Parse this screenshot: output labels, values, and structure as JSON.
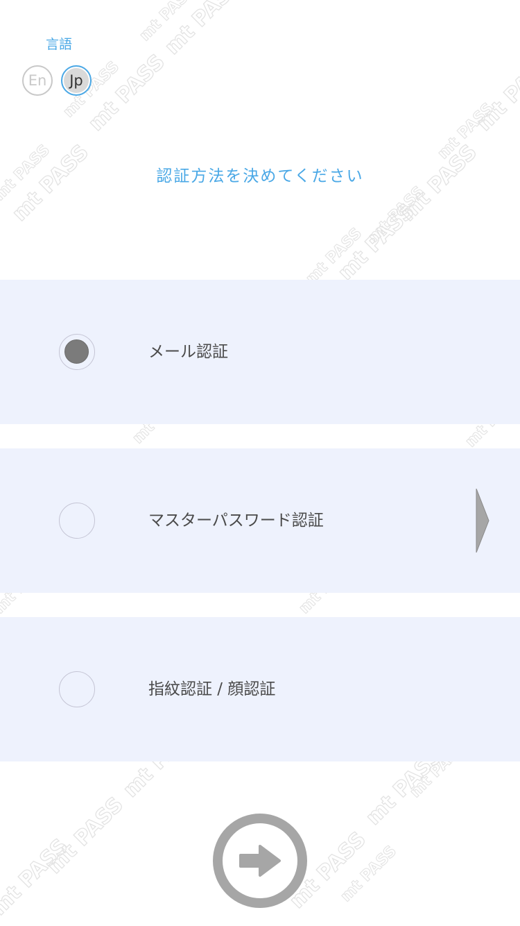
{
  "language": {
    "label": "言語",
    "options": [
      "En",
      "Jp"
    ],
    "selected": "Jp"
  },
  "prompt": "認証方法を決めてください",
  "auth_options": [
    {
      "label": "メール認証",
      "selected": true
    },
    {
      "label": "マスターパスワード認証",
      "selected": false
    },
    {
      "label": "指紋認証 / 顔認証",
      "selected": false
    }
  ],
  "watermark": "mt PASS",
  "icons": {
    "next": "arrow-right-circle-icon",
    "chevron": "chevron-right-icon",
    "radio": "radio-icon"
  },
  "colors": {
    "accent": "#4aa8e6",
    "option_bg": "#eef2fd",
    "text": "#4a4a4a",
    "selected_dot": "#7b7b7b",
    "icon_gray": "#a6a6a6"
  }
}
